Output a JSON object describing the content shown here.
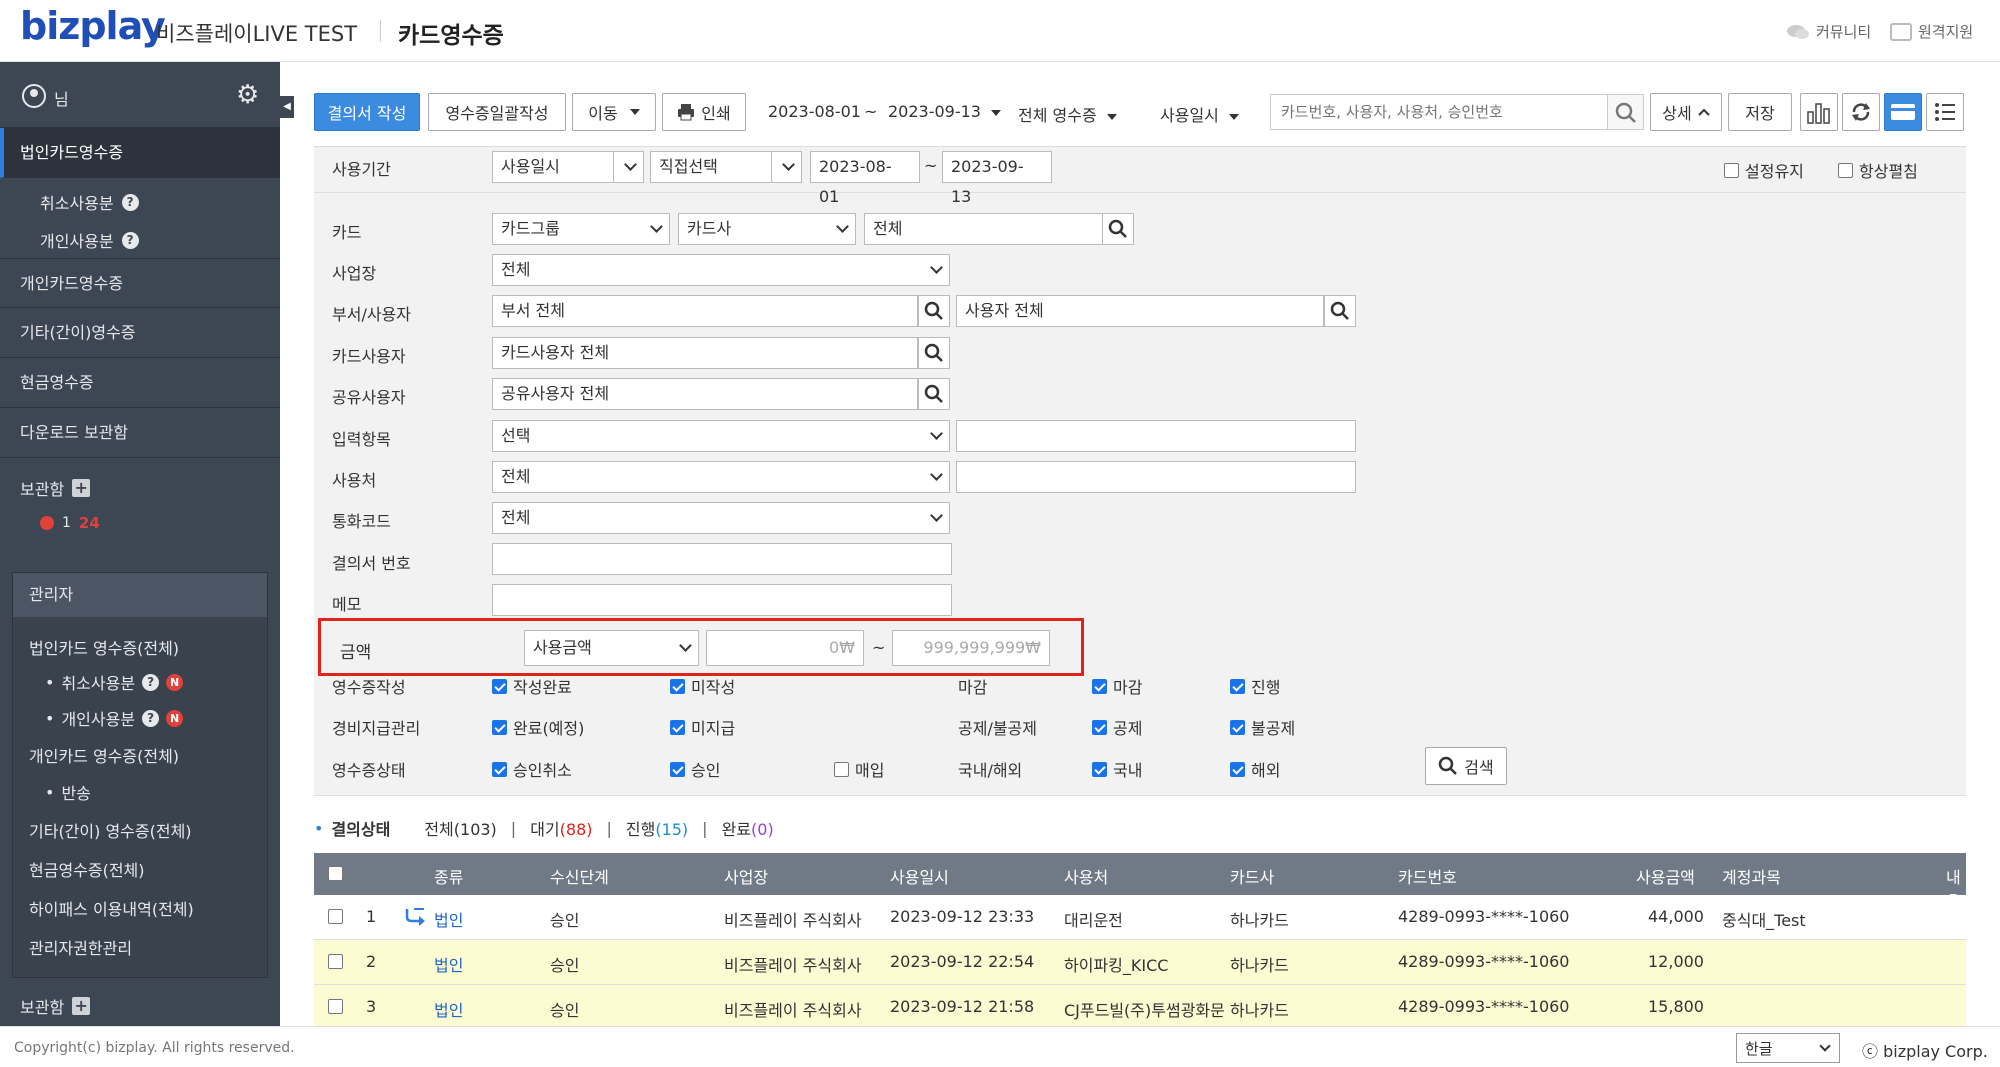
{
  "header": {
    "logo": "bizplay",
    "app_name": "비즈플레이LIVE TEST",
    "page_title": "카드영수증",
    "links": [
      {
        "label": "커뮤니티",
        "icon": "chat-bubble-icon"
      },
      {
        "label": "원격지원",
        "icon": "remote-support-icon"
      }
    ]
  },
  "sidebar": {
    "profile_name": "님",
    "items": [
      {
        "label": "법인카드영수증",
        "active": true
      },
      {
        "label": "개인카드영수증"
      },
      {
        "label": "기타(간이)영수증"
      },
      {
        "label": "현금영수증"
      },
      {
        "label": "다운로드 보관함"
      }
    ],
    "sub_items": [
      "취소사용분",
      "개인사용분"
    ],
    "archive_label": "보관함",
    "archive_num": "1",
    "archive_count": "24",
    "admin": {
      "title": "관리자",
      "items": [
        "법인카드 영수증(전체)",
        "취소사용분",
        "개인사용분",
        "개인카드 영수증(전체)",
        "반송",
        "기타(간이) 영수증(전체)",
        "현금영수증(전체)",
        "하이패스 이용내역(전체)",
        "관리자권한관리"
      ]
    },
    "archive_bottom": "보관함"
  },
  "toolbar": {
    "btn_report": "결의서 작성",
    "btn_batch": "영수증일괄작성",
    "btn_move": "이동",
    "btn_print": "인쇄",
    "date_from": "2023-08-01",
    "tilde": "~",
    "date_to": "2023-09-13",
    "receipt_filter": "전체 영수증",
    "sort_filter": "사용일시",
    "search_placeholder": "카드번호, 사용자, 사용처, 승인번호",
    "btn_detail": "상세",
    "btn_save": "저장"
  },
  "filters": {
    "period_label": "사용기간",
    "period_type": "사용일시",
    "period_select": "직접선택",
    "period_from": "2023-08-01",
    "period_to": "2023-09-13",
    "keep_setting": "설정유지",
    "always_open": "항상펼침",
    "card_label": "카드",
    "card_group": "카드그룹",
    "card_company": "카드사",
    "card_value": "전체",
    "biz_label": "사업장",
    "biz_value": "전체",
    "dept_label": "부서/사용자",
    "dept_value": "부서 전체",
    "user_value": "사용자 전체",
    "card_user_label": "카드사용자",
    "card_user_value": "카드사용자 전체",
    "shared_label": "공유사용자",
    "shared_value": "공유사용자 전체",
    "input_label": "입력항목",
    "input_value": "선택",
    "merchant_label": "사용처",
    "merchant_value": "전체",
    "currency_label": "통화코드",
    "currency_value": "전체",
    "report_no_label": "결의서 번호",
    "memo_label": "메모",
    "amount_label": "금액",
    "amount_type": "사용금액",
    "amount_from": "0₩",
    "amount_to": "999,999,999₩",
    "receipt_write_label": "영수증작성",
    "rw_done": "작성완료",
    "rw_not": "미작성",
    "close_label": "마감",
    "close_done": "마감",
    "close_progress": "진행",
    "expense_label": "경비지급관리",
    "exp_done": "완료(예정)",
    "exp_not": "미지급",
    "deduct_label": "공제/불공제",
    "deduct_yes": "공제",
    "deduct_no": "불공제",
    "receipt_status_label": "영수증상태",
    "rs_cancel": "승인취소",
    "rs_approve": "승인",
    "rs_purchase": "매입",
    "region_label": "국내/해외",
    "region_dom": "국내",
    "region_abroad": "해외",
    "search_btn": "검색"
  },
  "status_bar": {
    "label": "결의상태",
    "all": "전체(103)",
    "wait_label": "대기",
    "wait_count": "(88)",
    "progress_label": "진행",
    "progress_count": "(15)",
    "done_label": "완료",
    "done_count": "(0)",
    "colors": {
      "wait": "#e2231a",
      "progress": "#1a8fd8",
      "done": "#9b3fd0"
    }
  },
  "table": {
    "headers": [
      "종류",
      "수신단계",
      "사업장",
      "사용일시",
      "사용처",
      "카드사",
      "카드번호",
      "사용금액",
      "계정과목",
      "내용"
    ],
    "rows": [
      {
        "no": "1",
        "type": "법인",
        "stage": "승인",
        "biz": "비즈플레이 주식회사",
        "date": "2023-09-12 23:33",
        "merchant": "대리운전",
        "company": "하나카드",
        "card": "4289-0993-****-1060",
        "amount": "44,000",
        "account": "중식대_Test"
      },
      {
        "no": "2",
        "type": "법인",
        "stage": "승인",
        "biz": "비즈플레이 주식회사",
        "date": "2023-09-12 22:54",
        "merchant": "하이파킹_KICC",
        "company": "하나카드",
        "card": "4289-0993-****-1060",
        "amount": "12,000",
        "account": ""
      },
      {
        "no": "3",
        "type": "법인",
        "stage": "승인",
        "biz": "비즈플레이 주식회사",
        "date": "2023-09-12 21:58",
        "merchant": "CJ푸드빌(주)투썸광화문",
        "company": "하나카드",
        "card": "4289-0993-****-1060",
        "amount": "15,800",
        "account": ""
      }
    ]
  },
  "footer": {
    "copyright": "Copyright(c) bizplay. All rights reserved.",
    "language": "한글",
    "corp": "ⓒ bizplay Corp."
  }
}
